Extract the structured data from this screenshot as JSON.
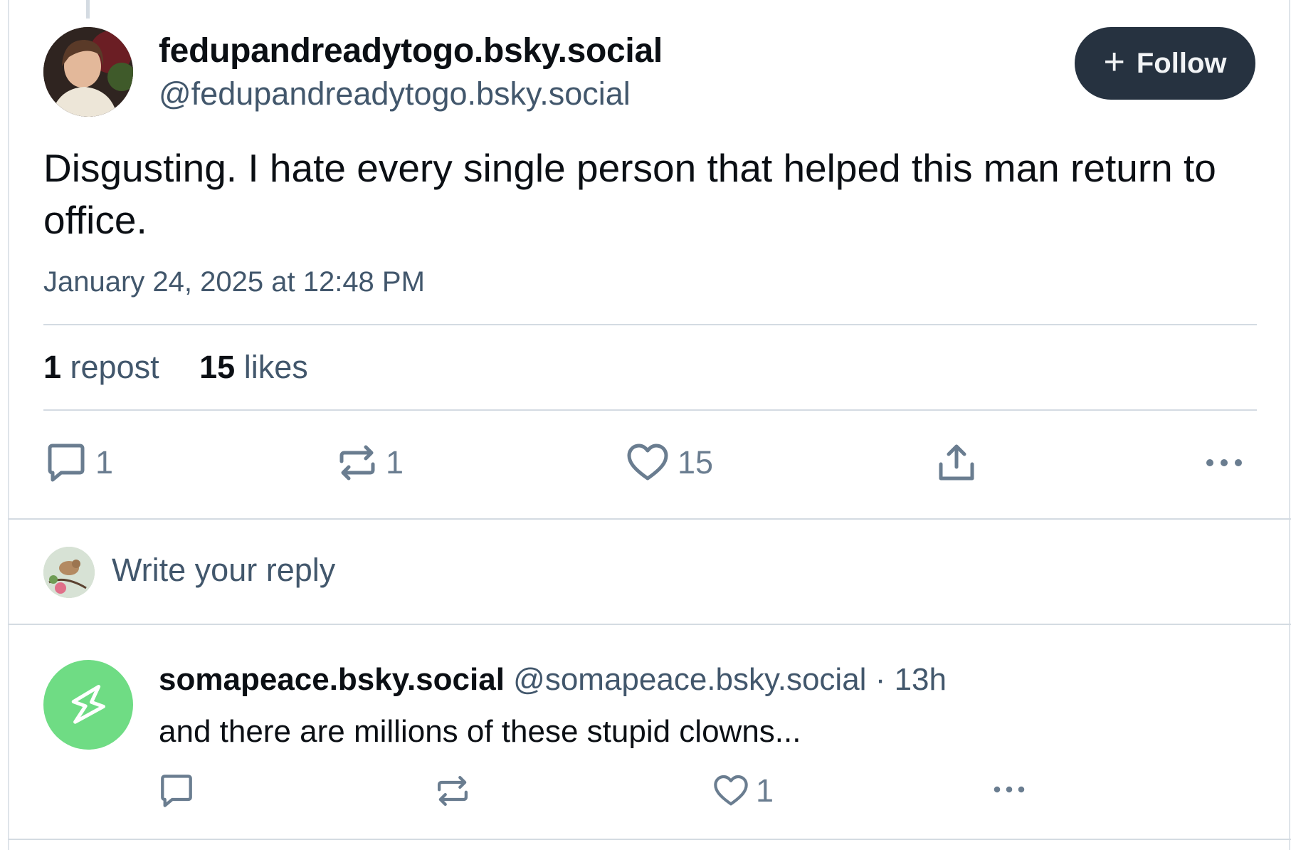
{
  "post": {
    "display_name": "fedupandreadytogo.bsky.social",
    "handle": "@fedupandreadytogo.bsky.social",
    "follow_label": "Follow",
    "text": "Disgusting. I hate every single person that helped this man return to office.",
    "timestamp": "January 24, 2025 at 12:48 PM",
    "stats": {
      "reposts_count": "1",
      "reposts_label": "repost",
      "likes_count": "15",
      "likes_label": "likes"
    },
    "actions": {
      "reply_count": "1",
      "repost_count": "1",
      "like_count": "15"
    }
  },
  "composer": {
    "placeholder": "Write your reply"
  },
  "reply": {
    "display_name": "somapeace.bsky.social",
    "handle": "@somapeace.bsky.social",
    "separator": "·",
    "age": "13h",
    "text": "and there are millions of these stupid clowns...",
    "actions": {
      "like_count": "1"
    }
  },
  "icons": {
    "follow": "plus-icon",
    "reply": "comment-icon",
    "repost": "repost-icon",
    "like": "heart-icon",
    "share": "share-icon",
    "more": "more-icon"
  },
  "colors": {
    "follow_button": "#263240",
    "muted_text": "#42576c",
    "icon": "#6a7d90",
    "divider": "#d4dbe2",
    "reply_avatar": "#6fdc84"
  }
}
